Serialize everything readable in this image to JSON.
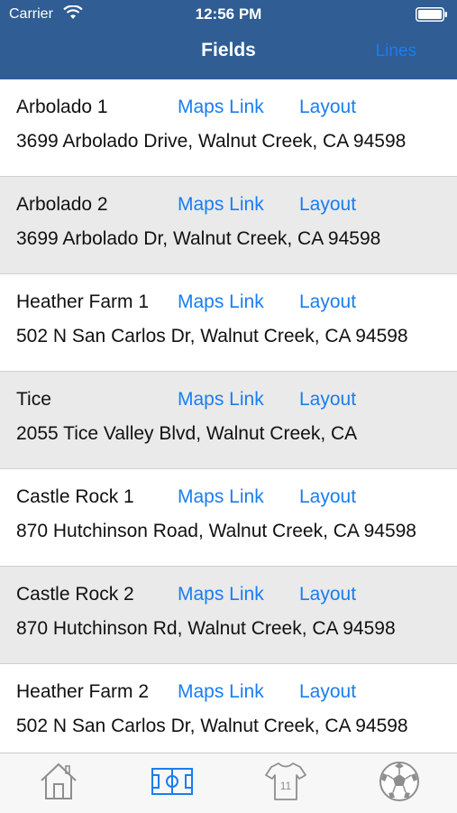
{
  "status_bar": {
    "carrier": "Carrier",
    "time": "12:56 PM"
  },
  "nav": {
    "title": "Fields",
    "right_button": "Lines"
  },
  "fields": [
    {
      "name": "Arbolado 1",
      "maps_label": "Maps Link",
      "layout_label": "Layout",
      "address": "3699 Arbolado Drive, Walnut Creek, CA 94598"
    },
    {
      "name": "Arbolado 2",
      "maps_label": "Maps Link",
      "layout_label": "Layout",
      "address": "3699 Arbolado Dr, Walnut Creek, CA 94598"
    },
    {
      "name": "Heather Farm 1",
      "maps_label": "Maps Link",
      "layout_label": "Layout",
      "address": "502 N San Carlos Dr, Walnut Creek, CA 94598"
    },
    {
      "name": "Tice",
      "maps_label": "Maps Link",
      "layout_label": "Layout",
      "address": "2055 Tice Valley Blvd, Walnut Creek, CA"
    },
    {
      "name": "Castle Rock 1",
      "maps_label": "Maps Link",
      "layout_label": "Layout",
      "address": "870 Hutchinson Road, Walnut Creek, CA 94598"
    },
    {
      "name": "Castle Rock 2",
      "maps_label": "Maps Link",
      "layout_label": "Layout",
      "address": "870 Hutchinson Rd, Walnut Creek, CA 94598"
    },
    {
      "name": "Heather Farm 2",
      "maps_label": "Maps Link",
      "layout_label": "Layout",
      "address": "502 N San Carlos Dr, Walnut Creek, CA 94598"
    }
  ],
  "tabs": [
    {
      "icon": "home-icon",
      "selected": false
    },
    {
      "icon": "field-icon",
      "selected": true
    },
    {
      "icon": "jersey-icon",
      "jersey_number": "11",
      "selected": false
    },
    {
      "icon": "soccer-ball-icon",
      "selected": false
    }
  ],
  "colors": {
    "nav_bar": "#2f5d94",
    "accent": "#1a7df0",
    "alt_row": "#eaeaea",
    "tab_inactive": "#8e8e8e"
  }
}
